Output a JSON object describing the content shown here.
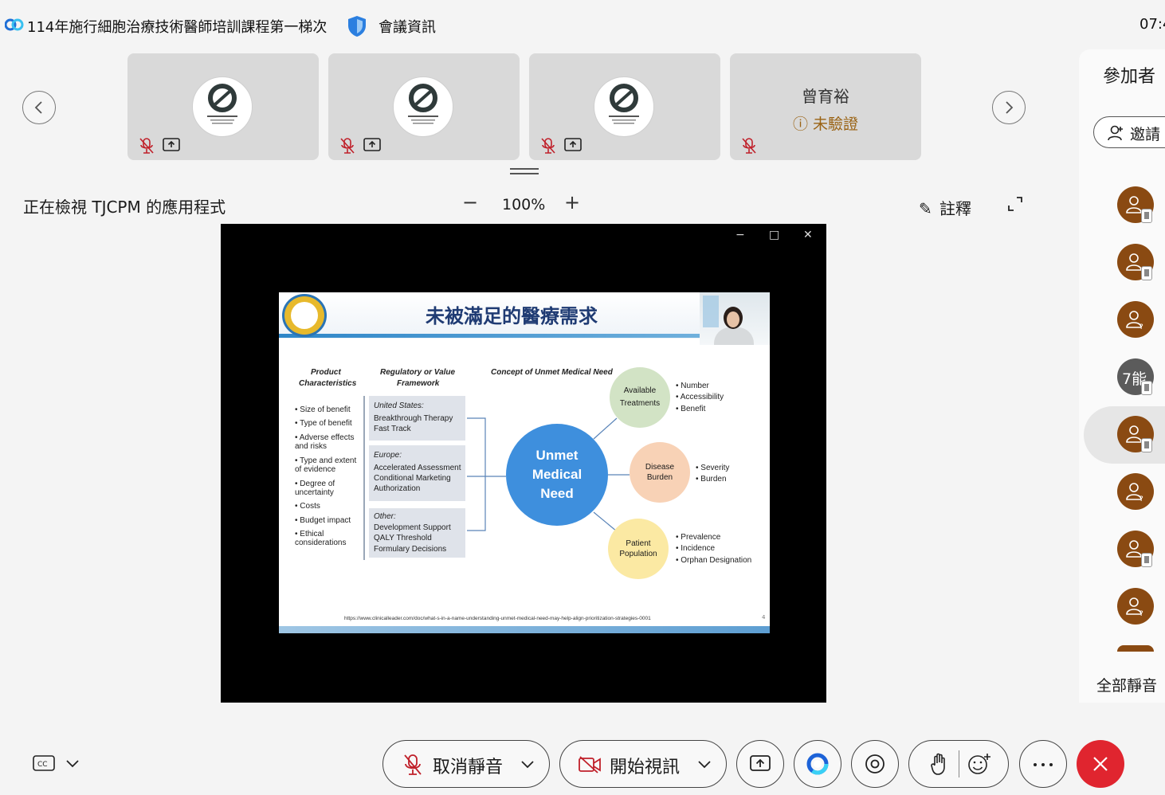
{
  "titlebar": {
    "meeting_title": "114年施行細胞治療技術醫師培訓課程第一梯次",
    "meeting_info": "會議資訊",
    "clock": "07:4"
  },
  "thumbnails": [
    {
      "type": "logo"
    },
    {
      "type": "logo"
    },
    {
      "type": "logo"
    },
    {
      "type": "name",
      "name": "曾育裕",
      "status": "未驗證"
    }
  ],
  "share_header": {
    "viewing": "正在檢視 TJCPM 的應用程式",
    "zoom_minus": "−",
    "zoom": "100%",
    "zoom_plus": "+",
    "annotate": "註釋"
  },
  "window_controls": {
    "minimize": "−",
    "maximize": "□",
    "close": "✕"
  },
  "slide": {
    "title": "未被滿足的醫療需求",
    "col1_header": [
      "Product",
      "Characteristics"
    ],
    "col2_header": [
      "Regulatory or Value",
      "Framework"
    ],
    "col3_header": "Concept of Unmet Medical Need",
    "product_characteristics": [
      [
        "• Size of benefit"
      ],
      [
        "• Type of benefit"
      ],
      [
        "• Adverse effects",
        "  and risks"
      ],
      [
        "• Type and extent",
        "  of evidence"
      ],
      [
        "• Degree of",
        "  uncertainty"
      ],
      [
        "• Costs"
      ],
      [
        "• Budget impact"
      ],
      [
        "• Ethical",
        "  considerations"
      ]
    ],
    "frameworks": [
      {
        "region": "United States:",
        "items": [
          "Breakthrough Therapy",
          "Fast Track"
        ]
      },
      {
        "region": "Europe:",
        "items": [
          "Accelerated Assessment",
          "Conditional Marketing",
          "Authorization"
        ]
      },
      {
        "region": "Other:",
        "items": [
          "Development Support",
          "QALY Threshold",
          "Formulary Decisions"
        ]
      }
    ],
    "center": [
      "Unmet",
      "Medical",
      "Need"
    ],
    "nodes": [
      {
        "label": [
          "Available",
          "Treatments"
        ],
        "bullets": [
          "• Number",
          "• Accessibility",
          "• Benefit"
        ]
      },
      {
        "label": [
          "Disease",
          "Burden"
        ],
        "bullets": [
          "• Severity",
          "• Burden"
        ]
      },
      {
        "label": [
          "Patient",
          "Population"
        ],
        "bullets": [
          "• Prevalence",
          "• Incidence",
          "• Orphan Designation"
        ]
      }
    ],
    "source": "https://www.clinicalleader.com/doc/what-s-in-a-name-understanding-unmet-medical-need-may-help-align-prioritization-strategies-0001",
    "page": "4"
  },
  "participants": {
    "title": "參加者",
    "invite": "邀請",
    "grey_initials": "7能",
    "mute_all": "全部靜音"
  },
  "toolbar": {
    "unmute": "取消靜音",
    "start_video": "開始視訊"
  },
  "colors": {
    "end_call": "#e0252f",
    "avatar": "#8a4a12",
    "unverified": "#9a6314",
    "unmet_circle": "#3e8fdd"
  }
}
